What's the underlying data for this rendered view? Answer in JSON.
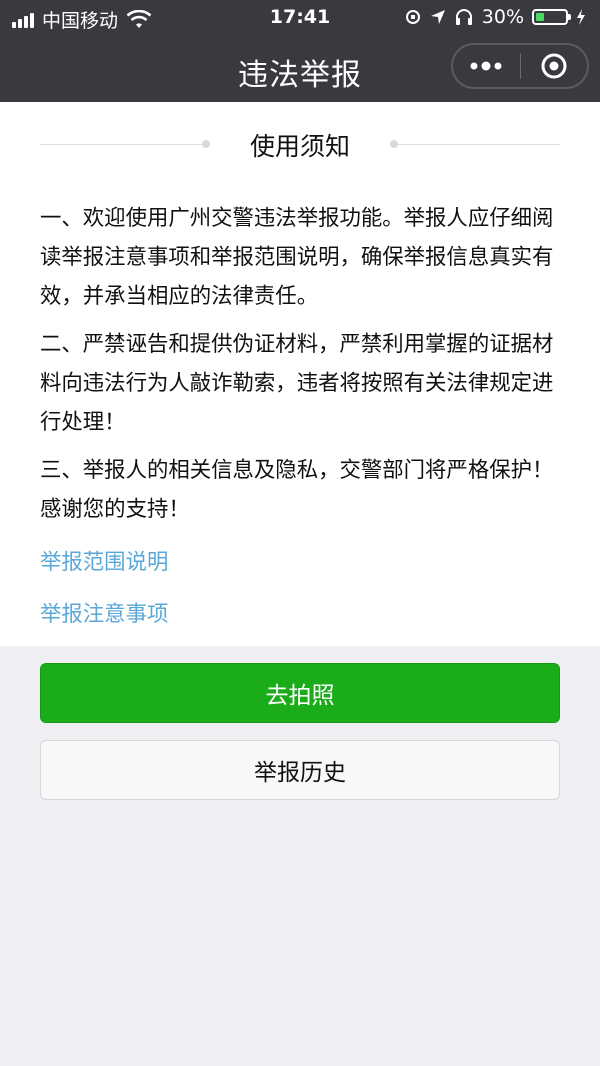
{
  "status_bar": {
    "carrier": "中国移动",
    "time": "17:41",
    "battery_percent": "30%",
    "battery_level": 0.3
  },
  "navbar": {
    "title": "违法举报",
    "more_icon": "more-icon",
    "close_icon": "close-circle-icon"
  },
  "notice": {
    "title": "使用须知",
    "paragraphs": [
      "一、欢迎使用广州交警违法举报功能。举报人应仔细阅读举报注意事项和举报范围说明，确保举报信息真实有效，并承当相应的法律责任。",
      "二、严禁诬告和提供伪证材料，严禁利用掌握的证据材料向违法行为人敲诈勒索，违者将按照有关法律规定进行处理！",
      "三、举报人的相关信息及隐私，交警部门将严格保护！感谢您的支持！"
    ],
    "links": [
      "举报范围说明",
      "举报注意事项"
    ]
  },
  "actions": {
    "take_photo": "去拍照",
    "history": "举报历史"
  },
  "colors": {
    "primary_green": "#1aad19",
    "link_blue": "#5ba7d8",
    "nav_bg": "#393a3f"
  }
}
